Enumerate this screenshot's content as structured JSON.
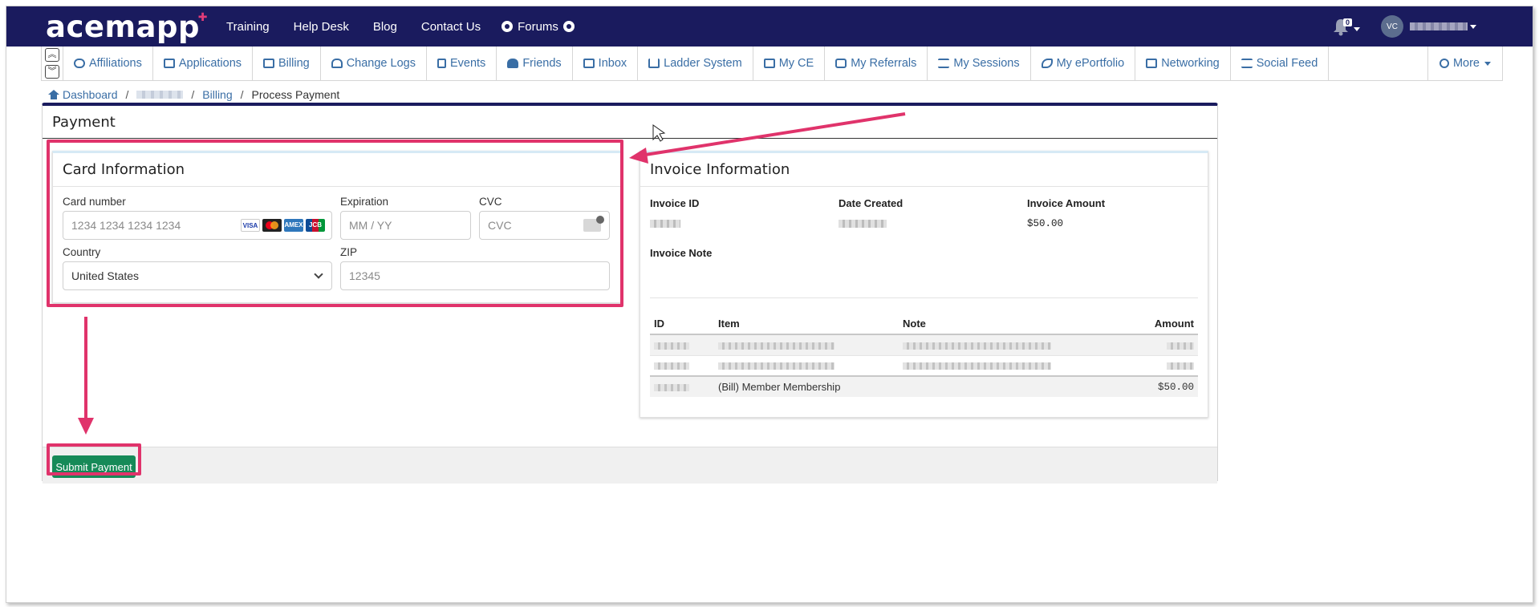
{
  "colors": {
    "nav_bg": "#1a1b5e",
    "link": "#3a6ea5",
    "submit": "#168a58",
    "annotation": "#e0336b"
  },
  "topnav": {
    "logo": "acemapp",
    "links": [
      "Training",
      "Help Desk",
      "Blog",
      "Contact Us"
    ],
    "forums": "Forums",
    "notification_count": "0",
    "user_initials": "VC"
  },
  "tabs": [
    {
      "label": "Affiliations",
      "icon": "link-icon"
    },
    {
      "label": "Applications",
      "icon": "id-card-icon"
    },
    {
      "label": "Billing",
      "icon": "money-icon"
    },
    {
      "label": "Change Logs",
      "icon": "cloud-icon"
    },
    {
      "label": "Events",
      "icon": "calendar-icon"
    },
    {
      "label": "Friends",
      "icon": "users-icon"
    },
    {
      "label": "Inbox",
      "icon": "inbox-icon"
    },
    {
      "label": "Ladder System",
      "icon": "ladder-icon"
    },
    {
      "label": "My CE",
      "icon": "institution-icon"
    },
    {
      "label": "My Referrals",
      "icon": "retweet-icon"
    },
    {
      "label": "My Sessions",
      "icon": "list-icon"
    },
    {
      "label": "My ePortfolio",
      "icon": "rocket-icon"
    },
    {
      "label": "Networking",
      "icon": "sitemap-icon"
    },
    {
      "label": "Social Feed",
      "icon": "list-icon"
    }
  ],
  "more_label": "More",
  "breadcrumb": {
    "home": "Dashboard",
    "billing": "Billing",
    "current": "Process Payment"
  },
  "payment": {
    "title": "Payment",
    "card": {
      "title": "Card Information",
      "card_number_label": "Card number",
      "card_number_placeholder": "1234 1234 1234 1234",
      "expiration_label": "Expiration",
      "expiration_placeholder": "MM / YY",
      "cvc_label": "CVC",
      "cvc_placeholder": "CVC",
      "country_label": "Country",
      "country_value": "United States",
      "zip_label": "ZIP",
      "zip_placeholder": "12345",
      "brands": [
        "VISA",
        "AMEX",
        "JCB"
      ]
    },
    "invoice": {
      "title": "Invoice Information",
      "id_label": "Invoice ID",
      "date_label": "Date Created",
      "amount_label": "Invoice Amount",
      "amount_value": "$50.00",
      "note_label": "Invoice Note",
      "table_headers": [
        "ID",
        "Item",
        "Note",
        "Amount"
      ],
      "last_row": {
        "item": "(Bill) Member Membership",
        "amount": "$50.00"
      }
    },
    "submit_label": "Submit Payment"
  }
}
